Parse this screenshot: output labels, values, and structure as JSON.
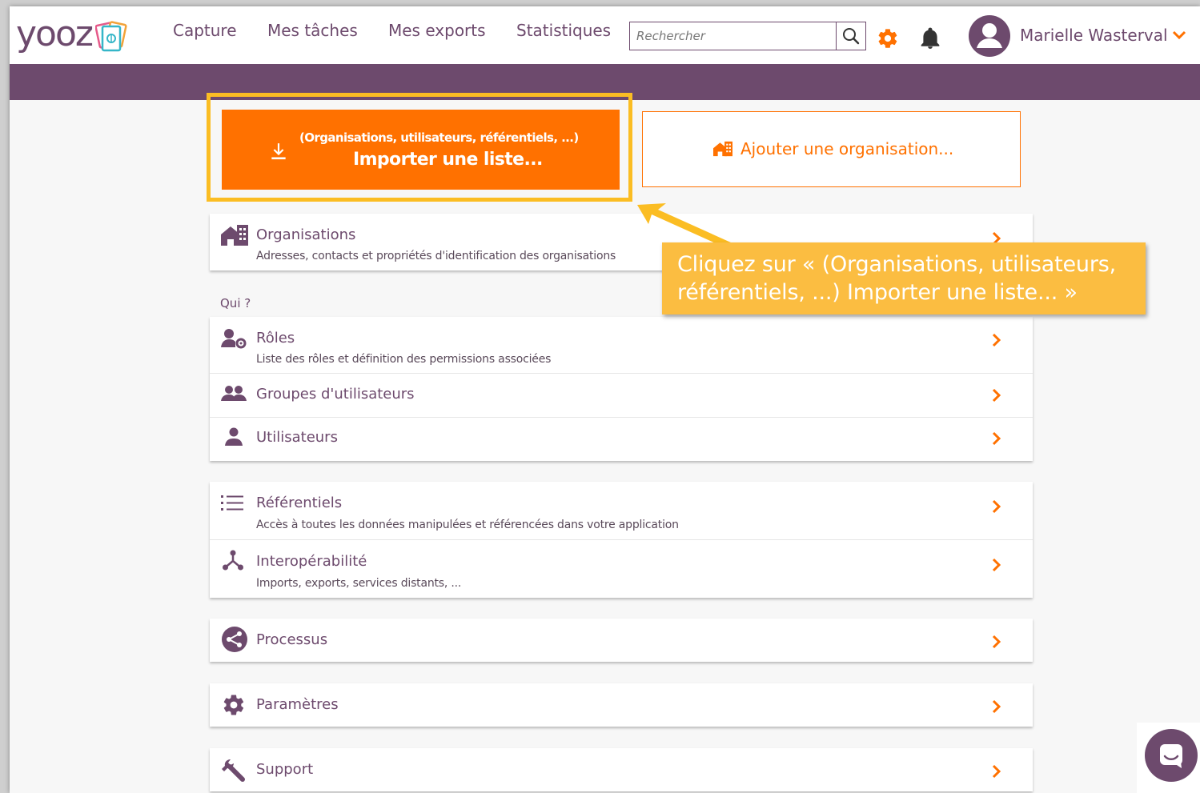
{
  "topbar": {
    "logo_text": "yooz",
    "nav": [
      "Capture",
      "Mes tâches",
      "Mes exports",
      "Statistiques"
    ],
    "search_placeholder": "Rechercher",
    "user_name": "Marielle Wasterval"
  },
  "actions": {
    "import_sub": "(Organisations, utilisateurs, référentiels, ...)",
    "import_main": "Importer une liste...",
    "add_org": "Ajouter une organisation..."
  },
  "sections": {
    "organisations": {
      "title": "Organisations",
      "desc": "Adresses, contacts et propriétés d'identification des organisations"
    },
    "qui_label": "Qui ?",
    "roles": {
      "title": "Rôles",
      "desc": "Liste des rôles et définition des permissions associées"
    },
    "groupes": {
      "title": "Groupes d'utilisateurs"
    },
    "utilisateurs": {
      "title": "Utilisateurs"
    },
    "referentiels": {
      "title": "Référentiels",
      "desc": "Accès à toutes les données manipulées et référencées dans votre application"
    },
    "interop": {
      "title": "Interopérabilité",
      "desc": "Imports, exports, services distants, ..."
    },
    "processus": {
      "title": "Processus"
    },
    "parametres": {
      "title": "Paramètres"
    },
    "support": {
      "title": "Support"
    }
  },
  "callout": {
    "text": "Cliquez sur « (Organisations, utilisateurs, référentiels, ...) Importer une liste... »"
  },
  "colors": {
    "brand_purple": "#6d4a6d",
    "accent_orange": "#ff7100",
    "highlight_yellow": "#fbbd23"
  },
  "icons": [
    "logo-cards-icon",
    "search-icon",
    "gear-icon",
    "bell-icon",
    "avatar-icon",
    "chevron-down-icon",
    "download-icon",
    "building-icon",
    "user-gear-icon",
    "users-icon",
    "user-icon",
    "list-icon",
    "network-icon",
    "share-icon",
    "gear-icon",
    "wrench-icon",
    "chevron-right-icon",
    "chat-icon"
  ]
}
